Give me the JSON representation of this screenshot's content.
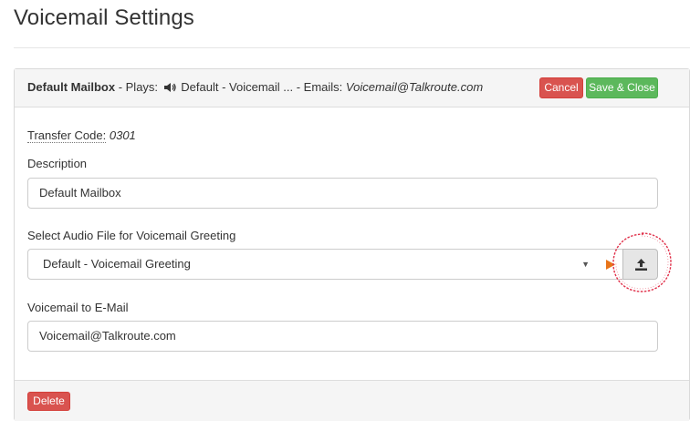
{
  "page": {
    "title": "Voicemail Settings"
  },
  "summary": {
    "mailbox_name": "Default Mailbox",
    "plays_label": " - Plays: ",
    "greeting": " Default - Voicemail ...",
    "emails_label": " - Emails: ",
    "email": "Voicemail@Talkroute.com"
  },
  "header_buttons": {
    "cancel": "Cancel",
    "save_close": "Save & Close"
  },
  "transfer": {
    "label": "Transfer Code:",
    "code": "0301"
  },
  "description": {
    "label": "Description",
    "value": "Default Mailbox"
  },
  "audio": {
    "label": "Select Audio File for Voicemail Greeting",
    "selected": "Default - Voicemail Greeting",
    "play_color": "#e8741a"
  },
  "email_field": {
    "label": "Voicemail to E-Mail",
    "value": "Voicemail@Talkroute.com"
  },
  "footer": {
    "delete": "Delete"
  },
  "icons": {
    "speaker": "speaker-icon",
    "play": "play-icon",
    "upload": "upload-icon",
    "caret": "caret-down-icon"
  },
  "colors": {
    "danger": "#d9534f",
    "success": "#5cb85c",
    "annotation": "#e0304a"
  }
}
